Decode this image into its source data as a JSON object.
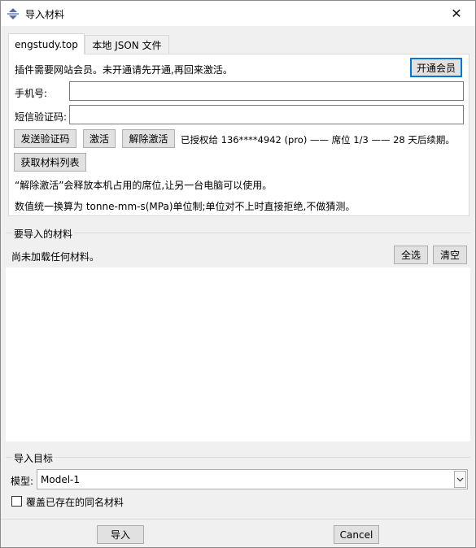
{
  "window": {
    "title": "导入材料",
    "close_glyph": "✕"
  },
  "tabs": [
    {
      "label": "engstudy.top",
      "active": true
    },
    {
      "label": "本地 JSON 文件",
      "active": false
    }
  ],
  "membership": {
    "notice": "插件需要网站会员。未开通请先开通,再回来激活。",
    "open_button": "开通会员"
  },
  "form": {
    "phone_label": "手机号:",
    "phone_value": "",
    "sms_label": "短信验证码:",
    "sms_value": ""
  },
  "actions": {
    "send_code": "发送验证码",
    "activate": "激活",
    "deactivate": "解除激活",
    "status": "已授权给 136****4942 (pro) —— 席位 1/3 —— 28 天后续期。",
    "fetch_list": "获取材料列表"
  },
  "notes": {
    "deactivate_hint": "“解除激活”会释放本机占用的席位,让另一台电脑可以使用。",
    "unit_hint": "数值统一换算为 tonne-mm-s(MPa)单位制;单位对不上时直接拒绝,不做猜测。"
  },
  "materials": {
    "group_title": "要导入的材料",
    "empty_text": "尚未加载任何材料。",
    "select_all": "全选",
    "clear": "清空",
    "items": []
  },
  "target": {
    "group_title": "导入目标",
    "model_label": "模型:",
    "model_value": "Model-1",
    "overwrite_label": "覆盖已存在的同名材料",
    "overwrite_checked": false
  },
  "footer": {
    "import_button": "导入",
    "cancel_button": "Cancel"
  },
  "icons": {
    "app": "app-arrows-icon",
    "combo": "chevron-down-icon"
  },
  "colors": {
    "accent": "#0078d7",
    "window_bg": "#f0f0f0",
    "panel_bg": "#ffffff"
  }
}
